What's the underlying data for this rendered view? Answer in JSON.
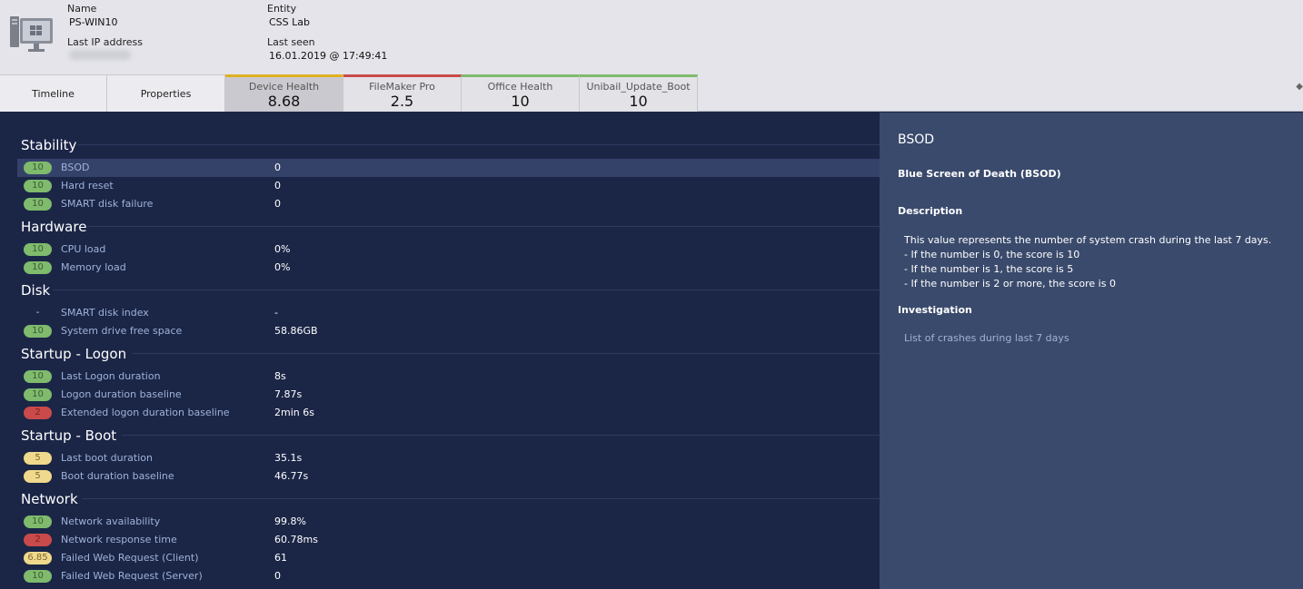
{
  "header": {
    "name_label": "Name",
    "name_value": "PS-WIN10",
    "ip_label": "Last IP address",
    "entity_label": "Entity",
    "entity_value": "CSS Lab",
    "last_seen_label": "Last seen",
    "last_seen_value": "16.01.2019 @ 17:49:41"
  },
  "tabs": [
    {
      "label": "Timeline"
    },
    {
      "label": "Properties"
    },
    {
      "label": "Device Health",
      "value": "8.68",
      "color": "#e0b020"
    },
    {
      "label": "FileMaker Pro",
      "value": "2.5",
      "color": "#c94a4a"
    },
    {
      "label": "Office Health",
      "value": "10",
      "color": "#7fba6d"
    },
    {
      "label": "Unibail_Update_Boot",
      "value": "10",
      "color": "#7fba6d"
    }
  ],
  "sections": {
    "stability": "Stability",
    "hardware": "Hardware",
    "disk": "Disk",
    "startup_logon": "Startup - Logon",
    "startup_boot": "Startup - Boot",
    "network": "Network"
  },
  "rows": [
    {
      "score": "10",
      "status": "green",
      "name": "BSOD",
      "value": "0"
    },
    {
      "score": "10",
      "status": "green",
      "name": "Hard reset",
      "value": "0"
    },
    {
      "score": "10",
      "status": "green",
      "name": "SMART disk failure",
      "value": "0"
    },
    {
      "score": "10",
      "status": "green",
      "name": "CPU load",
      "value": "0%"
    },
    {
      "score": "10",
      "status": "green",
      "name": "Memory load",
      "value": "0%"
    },
    {
      "score": "-",
      "status": "none",
      "name": "SMART disk index",
      "value": "-"
    },
    {
      "score": "10",
      "status": "green",
      "name": "System drive free space",
      "value": "58.86GB"
    },
    {
      "score": "10",
      "status": "green",
      "name": "Last Logon duration",
      "value": "8s"
    },
    {
      "score": "10",
      "status": "green",
      "name": "Logon duration baseline",
      "value": "7.87s"
    },
    {
      "score": "2",
      "status": "red",
      "name": "Extended logon duration baseline",
      "value": "2min 6s"
    },
    {
      "score": "5",
      "status": "yellow",
      "name": "Last boot duration",
      "value": "35.1s"
    },
    {
      "score": "5",
      "status": "yellow",
      "name": "Boot duration baseline",
      "value": "46.77s"
    },
    {
      "score": "10",
      "status": "green",
      "name": "Network availability",
      "value": "99.8%"
    },
    {
      "score": "2",
      "status": "red",
      "name": "Network response time",
      "value": "60.78ms"
    },
    {
      "score": "6.85",
      "status": "yellow",
      "name": "Failed Web Request (Client)",
      "value": "61"
    },
    {
      "score": "10",
      "status": "green",
      "name": "Failed Web Request (Server)",
      "value": "0"
    }
  ],
  "panel": {
    "title": "BSOD",
    "subtitle": "Blue Screen of Death (BSOD)",
    "description_heading": "Description",
    "description_lines": [
      "This value represents the number of system crash during the last 7 days.",
      "- If the number is 0, the score is 10",
      "- If the number is 1, the score is 5",
      "- If the number is 2 or more, the score is 0"
    ],
    "investigation_heading": "Investigation",
    "investigation_link": "List of crashes during last 7 days"
  },
  "icons": {
    "device": "computer-icon",
    "corner": "pin-icon"
  }
}
